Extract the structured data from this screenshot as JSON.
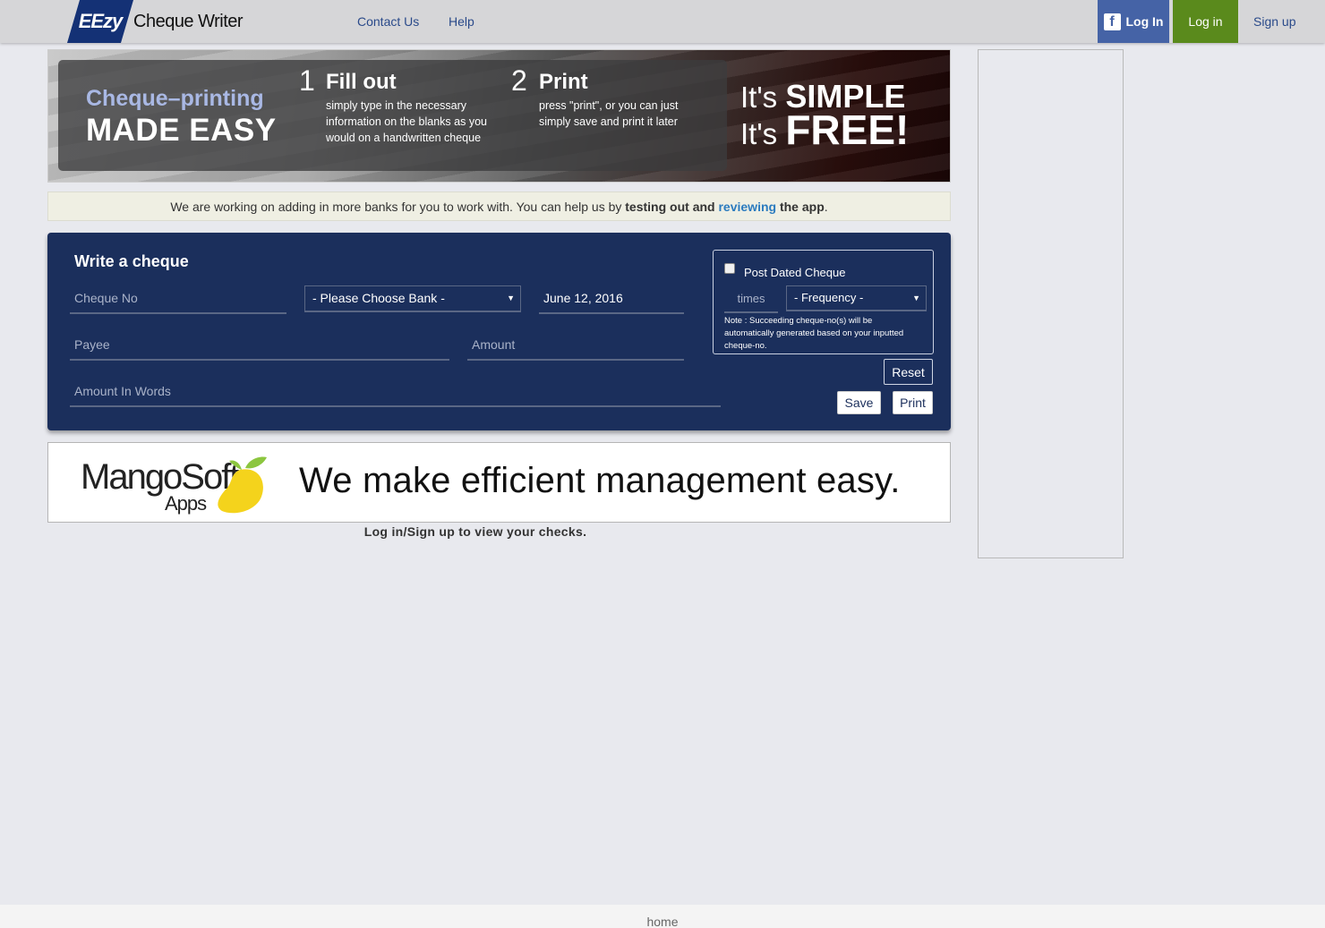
{
  "nav": {
    "logo_mark": "EEzy",
    "logo_text": "Cheque Writer",
    "links": [
      "Contact Us",
      "Help"
    ],
    "fb_login": "Log In",
    "fb_icon": "f",
    "login": "Log in",
    "signup": "Sign up"
  },
  "hero": {
    "tagline_line1": "Cheque–printing",
    "tagline_line2": "MADE EASY",
    "step1": {
      "num": "1",
      "title": "Fill out",
      "desc": "simply type in the necessary information on the blanks as you would on a handwritten cheque"
    },
    "step2": {
      "num": "2",
      "title": "Print",
      "desc": "press \"print\", or you can just simply save and print it later"
    },
    "simple_prefix": "It's",
    "simple_word": "SIMPLE",
    "free_prefix": "It's",
    "free_word": "FREE!"
  },
  "notice": {
    "text_start": "We are working on adding in more banks for you to work with. You can help us by",
    "bold1": "testing out and",
    "link": "reviewing",
    "bold2": "the app",
    "end": "."
  },
  "cheque_form": {
    "title": "Write a cheque",
    "cheque_no_placeholder": "Cheque No",
    "bank_select": "- Please Choose Bank -",
    "date_value": "June 12, 2016",
    "payee_placeholder": "Payee",
    "amount_placeholder": "Amount",
    "amount_words_placeholder": "Amount In Words",
    "post_dated": {
      "label": "Post Dated Cheque",
      "times_placeholder": "times",
      "frequency_select": "- Frequency -",
      "note": "Note : Succeeding cheque-no(s) will be automatically generated based on your inputted cheque-no."
    },
    "buttons": {
      "reset": "Reset",
      "save": "Save",
      "print": "Print"
    }
  },
  "ad": {
    "brand": "MangoSoft",
    "apps": "Apps",
    "slogan": "We make efficient management easy."
  },
  "login_note": "Log in/Sign up to view your checks.",
  "footer": {
    "home": "home"
  },
  "colors": {
    "nav_bg": "#d6d6d8",
    "brand_blue": "#143175",
    "facebook": "#4563a6",
    "login_green": "#5a8a1c",
    "form_bg": "#1b2f5c",
    "link_blue": "#2b7bbf",
    "mango_yellow": "#f4d31c",
    "mango_leaf": "#8cc63f"
  }
}
